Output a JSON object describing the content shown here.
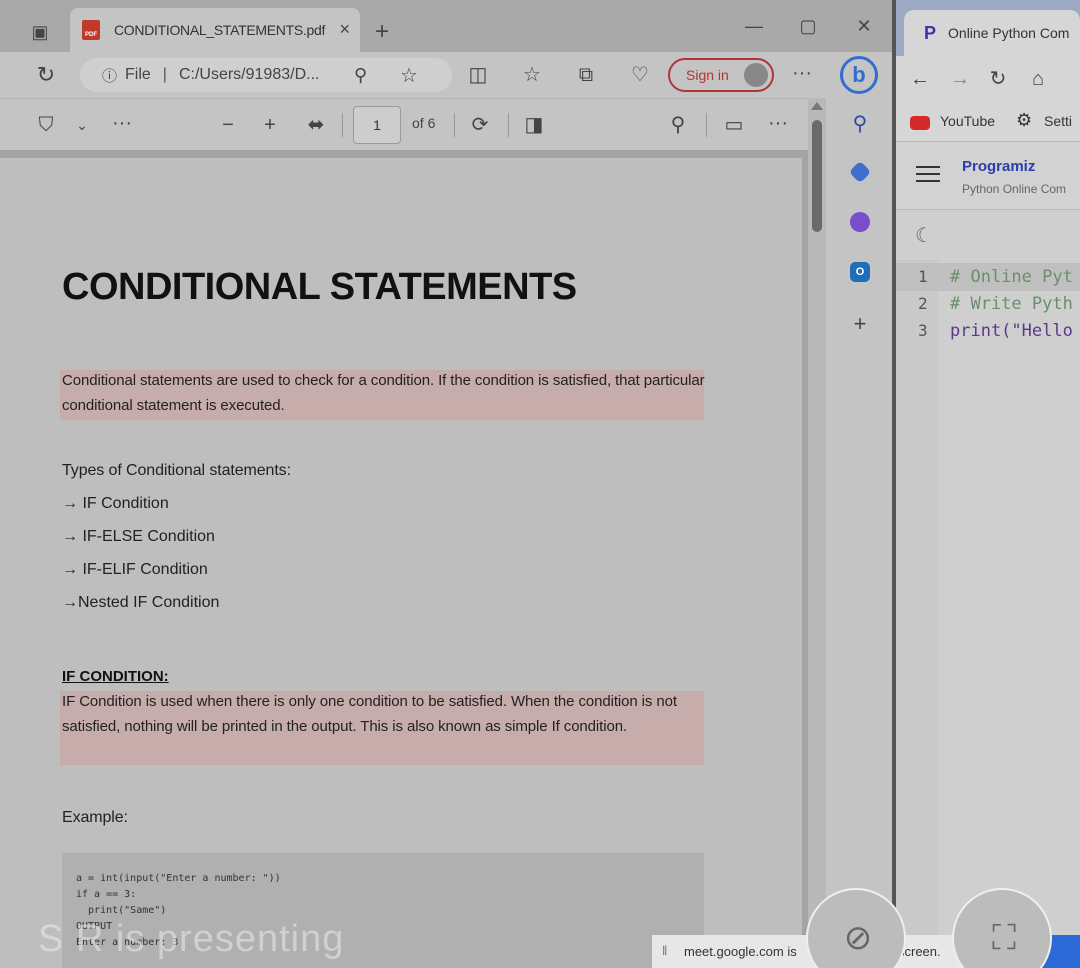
{
  "edge": {
    "tab_title": "CONDITIONAL_STATEMENTS.pdf",
    "tab_close": "×",
    "new_tab": "+",
    "address_label": "File",
    "address_sep": "|",
    "address_url": "C:/Users/91983/D...",
    "sign_in": "Sign in",
    "more": "···"
  },
  "pdf_toolbar": {
    "page_current": "1",
    "page_total": "of 6",
    "zoom_out": "−",
    "zoom_in": "+",
    "more": "···"
  },
  "document": {
    "title": "CONDITIONAL STATEMENTS",
    "intro": "Conditional statements are used to check for a condition. If the condition is satisfied, that particular conditional statement is executed.",
    "types_heading": "Types of Conditional statements:",
    "types": [
      "→ IF Condition",
      "→ IF-ELSE Condition",
      "→ IF-ELIF Condition",
      "→Nested IF Condition"
    ],
    "if_heading": "IF CONDITION:",
    "if_text": "IF Condition is used when there is only one condition to be satisfied. When the condition is not satisfied, nothing will be printed in the output. This is also known as simple If condition.",
    "example_label": "Example:",
    "code": [
      "a = int(input(\"Enter a number: \"))",
      "if a == 3:",
      "  print(\"Same\")",
      "",
      "OUTPUT",
      "Enter a number: 3"
    ]
  },
  "chrome": {
    "tab_title": "Online Python Com",
    "bookmark_youtube": "YouTube",
    "bookmark_settings": "Setti",
    "brand": "Programiz",
    "brand_sub": "Python Online Com",
    "code_lines": [
      {
        "num": "1",
        "text": "# Online Pyt",
        "color": "#6b8e6b"
      },
      {
        "num": "2",
        "text": "# Write Pyth",
        "color": "#6b8e6b"
      },
      {
        "num": "3",
        "text": "print(\"Hello",
        "color": "#5a3a8a"
      }
    ]
  },
  "meet": {
    "presenting": "S R is presenting",
    "bar_text": "meet.google.com is",
    "bar_text_2": "screen."
  }
}
